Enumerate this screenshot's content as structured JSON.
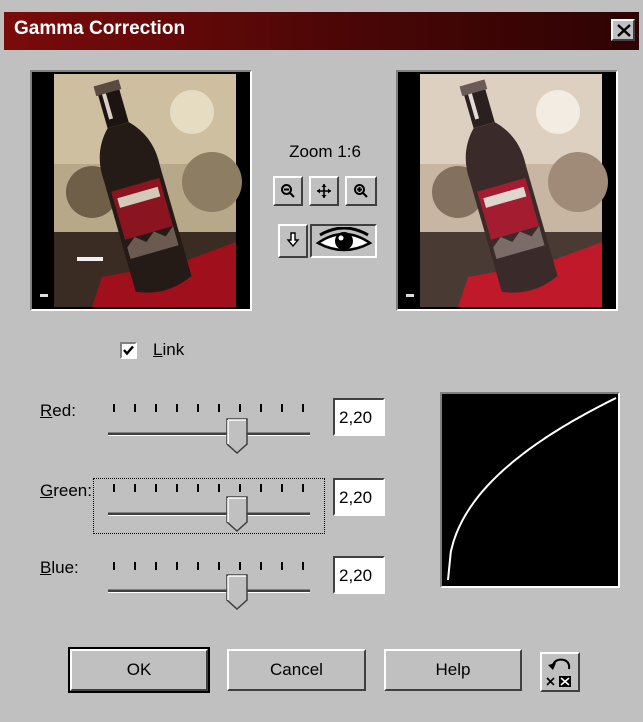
{
  "window": {
    "title": "Gamma Correction"
  },
  "zoom": {
    "label": "Zoom 1:6"
  },
  "link": {
    "label": "Link",
    "checked": true
  },
  "sliders": [
    {
      "label": "Red:",
      "value": "2,20",
      "level": 0.64
    },
    {
      "label": "Green:",
      "value": "2,20",
      "level": 0.64
    },
    {
      "label": "Blue:",
      "value": "2,20",
      "level": 0.64
    }
  ],
  "buttons": {
    "ok": "OK",
    "cancel": "Cancel",
    "help": "Help"
  },
  "icons": {
    "close": "close-icon",
    "zoom_out": "zoom-out-icon",
    "pan": "pan-icon",
    "zoom_in": "zoom-in-icon",
    "navigate": "hand-pointer-icon",
    "preview": "eye-icon",
    "reset": "reset-icon"
  },
  "colors": {
    "titlebar": "#7a0b0b",
    "face": "#c0c0c0",
    "curve": "#ffffff"
  }
}
